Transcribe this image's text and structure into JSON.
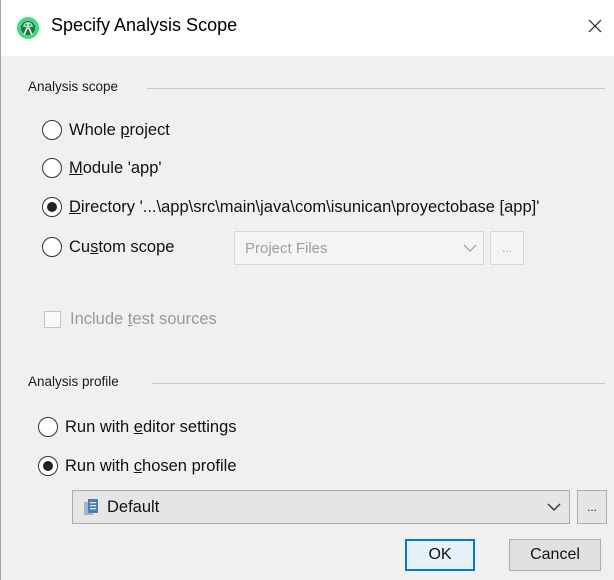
{
  "dialog": {
    "title": "Specify Analysis Scope",
    "close_glyph": "×"
  },
  "scope": {
    "header": "Analysis scope",
    "options": [
      {
        "pre": "Whole ",
        "mn": "p",
        "post": "roject",
        "selected": false
      },
      {
        "pre": "",
        "mn": "M",
        "post": "odule 'app'",
        "selected": false
      },
      {
        "pre": "",
        "mn": "D",
        "post": "irectory '...\\app\\src\\main\\java\\com\\isunican\\proyectobase [app]'",
        "selected": true
      },
      {
        "pre": "Cu",
        "mn": "s",
        "post": "tom scope",
        "selected": false
      }
    ],
    "custom_scope_combo": {
      "value": "Project Files",
      "enabled": false
    },
    "custom_scope_more": "...",
    "include_tests": {
      "pre": "Include ",
      "mn": "t",
      "post": "est sources",
      "checked": false,
      "enabled": false
    }
  },
  "profile": {
    "header": "Analysis profile",
    "options": [
      {
        "pre": "Run with ",
        "mn": "e",
        "post": "ditor settings",
        "selected": false
      },
      {
        "pre": "Run with ",
        "mn": "c",
        "post": "hosen profile",
        "selected": true
      }
    ],
    "profile_combo": {
      "value": "Default"
    },
    "profile_more": "..."
  },
  "buttons": {
    "ok": "OK",
    "cancel": "Cancel"
  },
  "icons": {
    "app": "android-studio-icon",
    "close": "close-icon",
    "chevron": "chevron-down-icon",
    "profile": "inspection-profile-icon"
  },
  "colors": {
    "accent": "#0078d7",
    "dialog_bg": "#f0f0f0",
    "app_icon_green": "#3ddc84"
  }
}
